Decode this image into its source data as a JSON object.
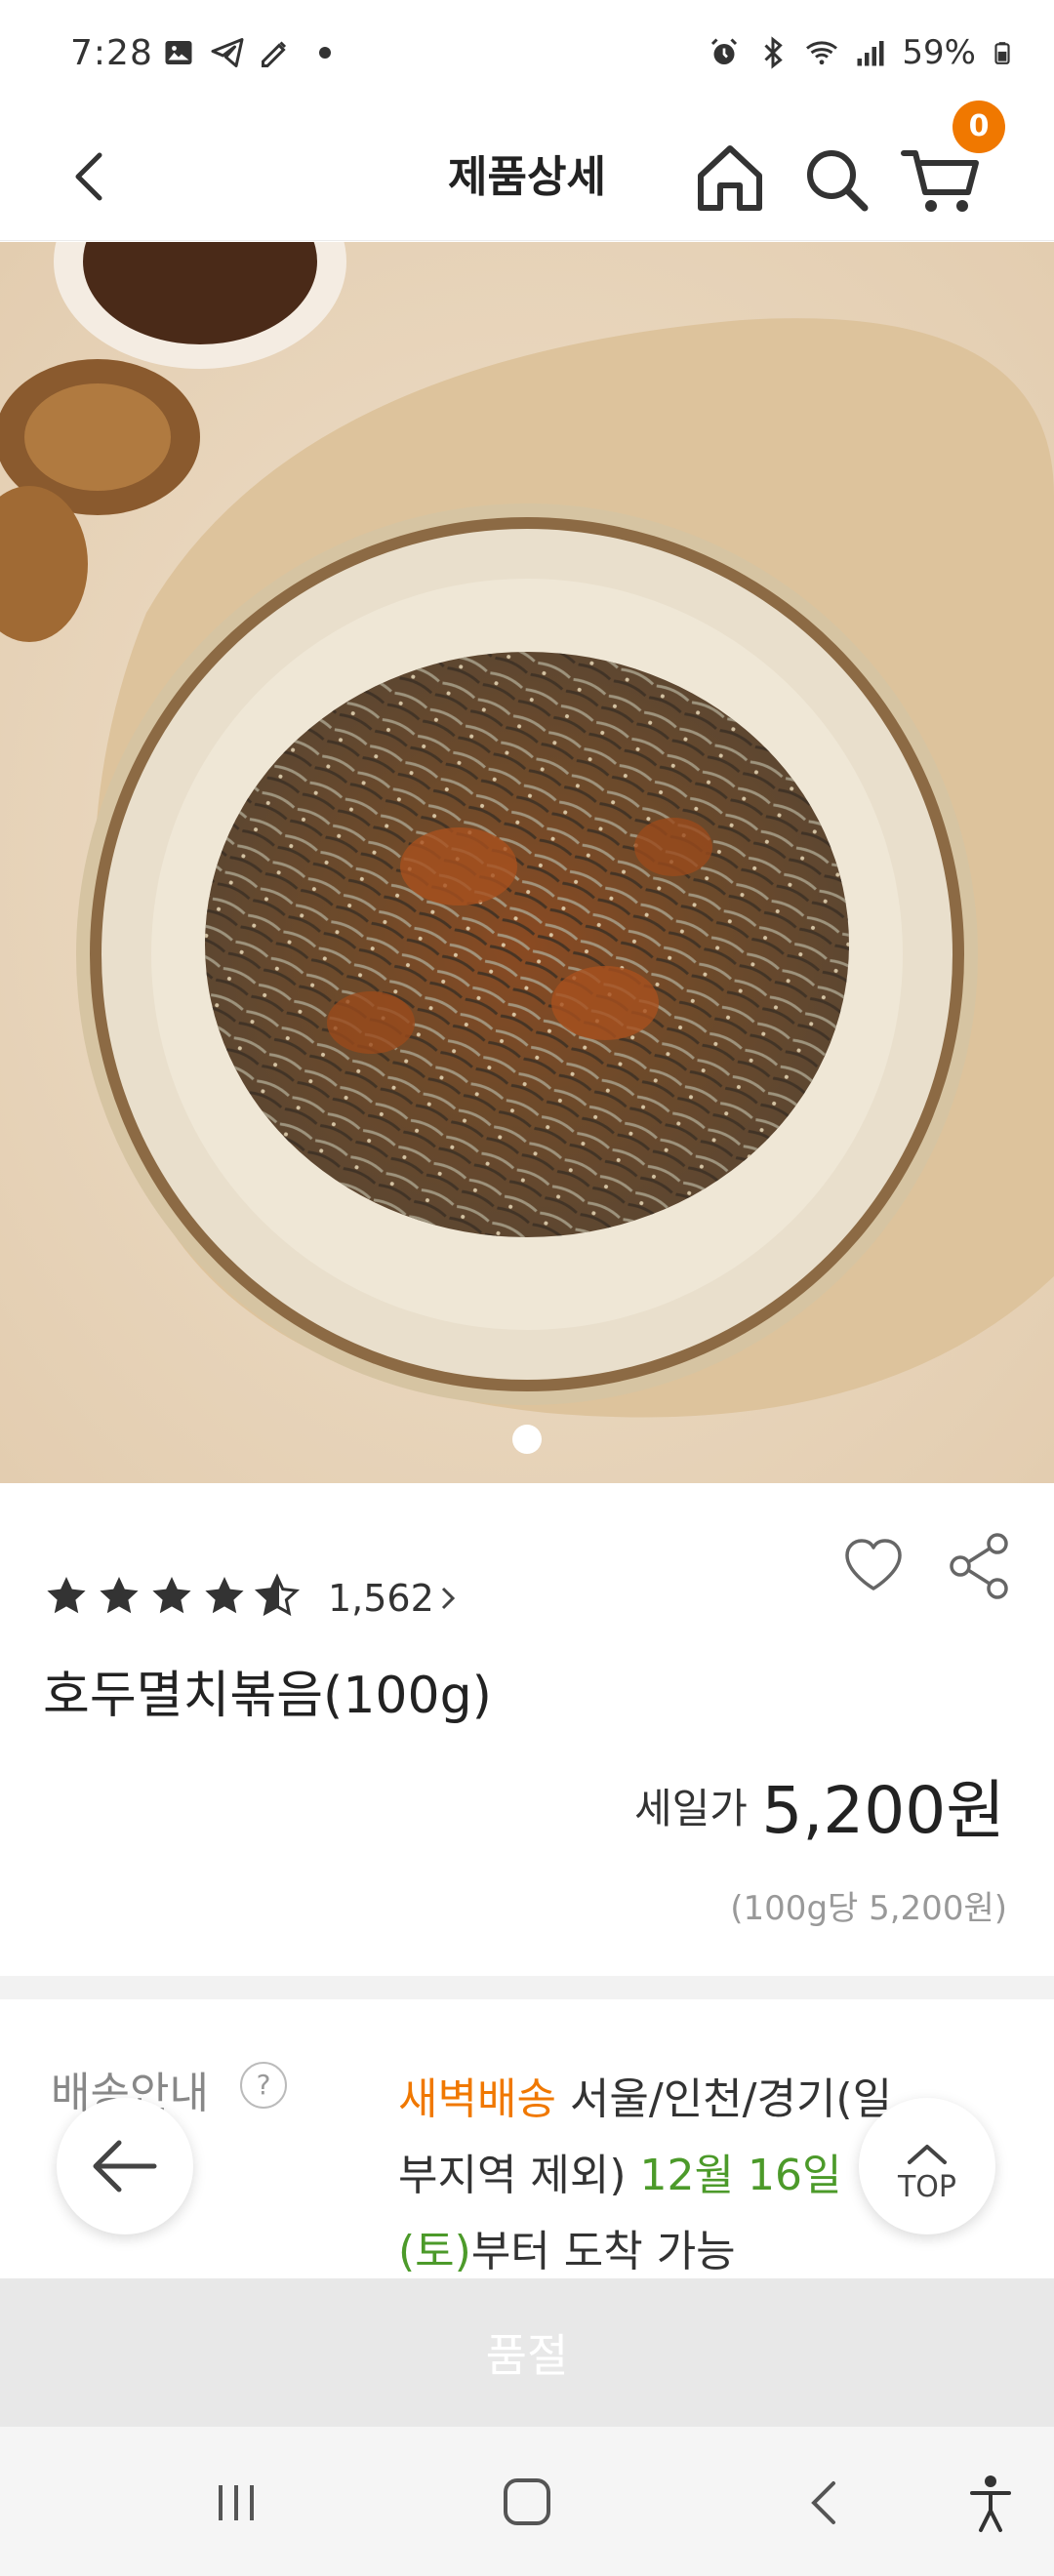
{
  "status_bar": {
    "time": "7:28",
    "battery": "59%"
  },
  "header": {
    "title": "제품상세",
    "cart_count": "0"
  },
  "product": {
    "rating_stars": 4.5,
    "review_count": "1,562",
    "name": "호두멸치볶음(100g)",
    "price_label": "세일가",
    "price": "5,200원",
    "unit_price": "(100g당 5,200원)"
  },
  "delivery": {
    "label": "배송안내",
    "help": "?",
    "type": "새벽배송",
    "area": " 서울/인천/경기(일부지역 제외) ",
    "date": "12월 16일 (토)",
    "suffix": "부터 도착 가능"
  },
  "floating": {
    "top_label": "TOP"
  },
  "cta": {
    "soldout_label": "품절"
  },
  "colors": {
    "accent": "#f07800",
    "date_green": "#4c9a2a",
    "soldout_bg": "#e8e8e8"
  }
}
